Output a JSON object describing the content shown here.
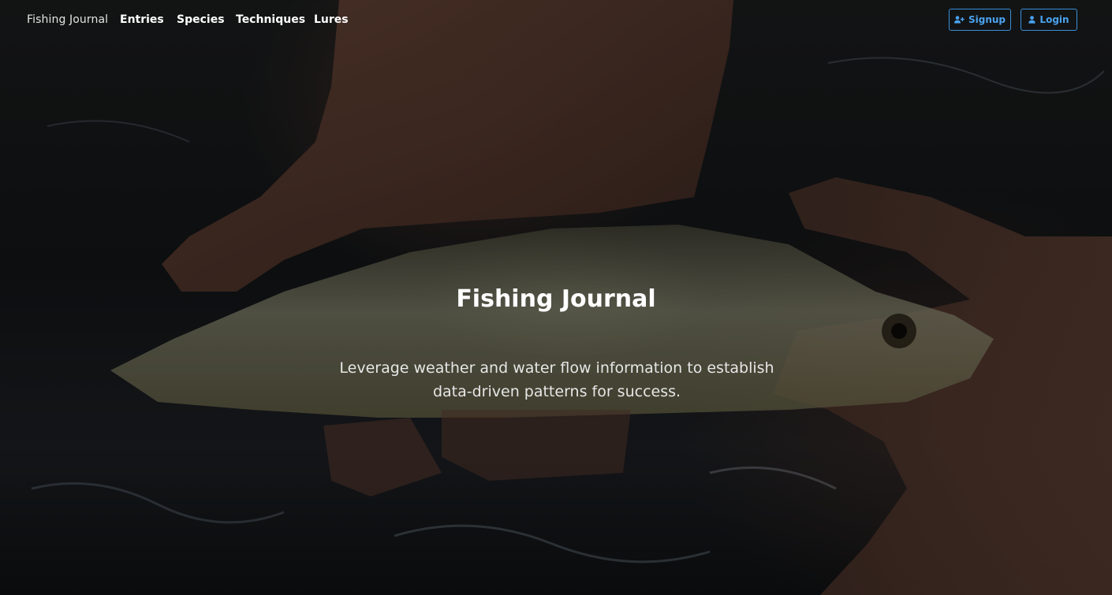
{
  "navbar": {
    "brand": "Fishing Journal",
    "links": [
      "Entries",
      "Species",
      "Techniques",
      "Lures"
    ],
    "signup_label": "Signup",
    "login_label": "Login",
    "signup_icon": "user-plus-icon",
    "login_icon": "user-icon",
    "accent_color": "#3a8fd9"
  },
  "hero": {
    "background_image": "hands-holding-trout-in-water",
    "title": "Fishing Journal",
    "subtitle": "Leverage weather and water flow information to establish data-driven patterns for success."
  }
}
